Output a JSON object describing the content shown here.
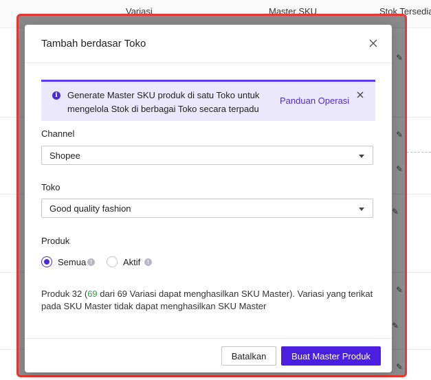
{
  "background": {
    "columns": [
      "Variasi",
      "Master SKU",
      "Stok Tersedia"
    ],
    "edit_icon": "pencil-icon"
  },
  "modal": {
    "title": "Tambah berdasar Toko",
    "close_icon": "close-icon",
    "banner": {
      "icon": "info-icon",
      "text": "Generate Master SKU produk di satu Toko untuk mengelola Stok di berbagai Toko secara terpadu",
      "link": "Panduan Operasi",
      "close_icon": "close-icon"
    },
    "channel": {
      "label": "Channel",
      "value": "Shopee"
    },
    "toko": {
      "label": "Toko",
      "value": "Good quality fashion"
    },
    "produk": {
      "label": "Produk",
      "options": [
        {
          "label": "Semua",
          "checked": true
        },
        {
          "label": "Aktif",
          "checked": false
        }
      ]
    },
    "description": {
      "prefix": "Produk 32 (",
      "highlight": "69",
      "suffix": " dari 69 Variasi dapat menghasilkan SKU Master). Variasi yang terikat pada SKU Master tidak dapat menghasilkan SKU Master"
    },
    "footer": {
      "cancel_label": "Batalkan",
      "submit_label": "Buat Master Produk"
    }
  },
  "colors": {
    "accent": "#4b1fe0",
    "banner_bg": "#ece8fb",
    "highlight_green": "#2ea043",
    "annotation_red": "#e53935"
  }
}
